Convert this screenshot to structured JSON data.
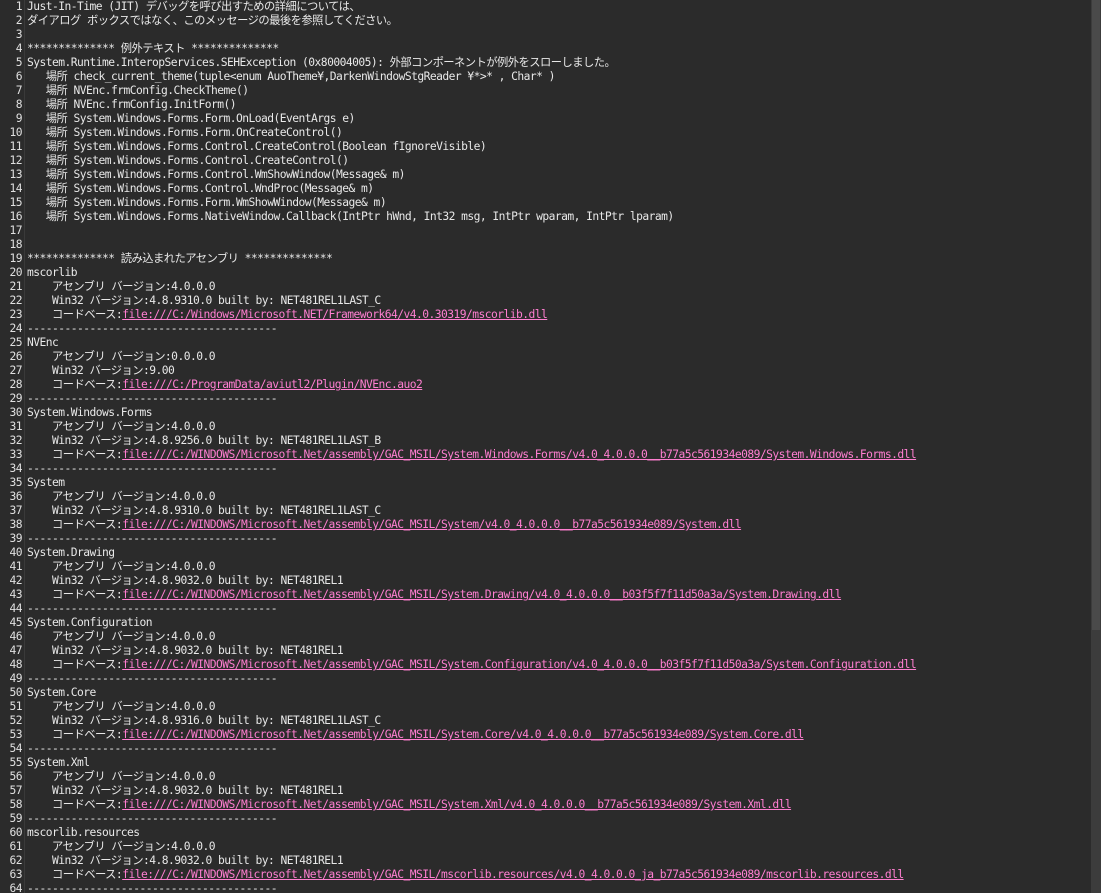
{
  "lines": [
    {
      "n": "1",
      "text": "Just-In-Time (JIT) デバッグを呼び出すための詳細については、"
    },
    {
      "n": "2",
      "text": "ダイアログ ボックスではなく、このメッセージの最後を参照してください。"
    },
    {
      "n": "3",
      "text": ""
    },
    {
      "n": "4",
      "text": "************** 例外テキスト **************"
    },
    {
      "n": "5",
      "text": "System.Runtime.InteropServices.SEHException (0x80004005): 外部コンポーネントが例外をスローしました。"
    },
    {
      "n": "6",
      "text": "   場所 check_current_theme(tuple<enum AuoTheme¥,DarkenWindowStgReader ¥*>* , Char* )"
    },
    {
      "n": "7",
      "text": "   場所 NVEnc.frmConfig.CheckTheme()"
    },
    {
      "n": "8",
      "text": "   場所 NVEnc.frmConfig.InitForm()"
    },
    {
      "n": "9",
      "text": "   場所 System.Windows.Forms.Form.OnLoad(EventArgs e)"
    },
    {
      "n": "10",
      "text": "   場所 System.Windows.Forms.Form.OnCreateControl()"
    },
    {
      "n": "11",
      "text": "   場所 System.Windows.Forms.Control.CreateControl(Boolean fIgnoreVisible)"
    },
    {
      "n": "12",
      "text": "   場所 System.Windows.Forms.Control.CreateControl()"
    },
    {
      "n": "13",
      "text": "   場所 System.Windows.Forms.Control.WmShowWindow(Message& m)"
    },
    {
      "n": "14",
      "text": "   場所 System.Windows.Forms.Control.WndProc(Message& m)"
    },
    {
      "n": "15",
      "text": "   場所 System.Windows.Forms.Form.WmShowWindow(Message& m)"
    },
    {
      "n": "16",
      "text": "   場所 System.Windows.Forms.NativeWindow.Callback(IntPtr hWnd, Int32 msg, IntPtr wparam, IntPtr lparam)"
    },
    {
      "n": "17",
      "text": ""
    },
    {
      "n": "18",
      "text": ""
    },
    {
      "n": "19",
      "text": "************** 読み込まれたアセンブリ **************"
    },
    {
      "n": "20",
      "text": "mscorlib"
    },
    {
      "n": "21",
      "text": "    アセンブリ バージョン:4.0.0.0"
    },
    {
      "n": "22",
      "text": "    Win32 バージョン:4.8.9310.0 built by: NET481REL1LAST_C"
    },
    {
      "n": "23",
      "text": "    コードベース:",
      "link": "file:///C:/Windows/Microsoft.NET/Framework64/v4.0.30319/mscorlib.dll"
    },
    {
      "n": "24",
      "text": "----------------------------------------"
    },
    {
      "n": "25",
      "text": "NVEnc"
    },
    {
      "n": "26",
      "text": "    アセンブリ バージョン:0.0.0.0"
    },
    {
      "n": "27",
      "text": "    Win32 バージョン:9.00"
    },
    {
      "n": "28",
      "text": "    コードベース:",
      "link": "file:///C:/ProgramData/aviutl2/Plugin/NVEnc.auo2"
    },
    {
      "n": "29",
      "text": "----------------------------------------"
    },
    {
      "n": "30",
      "text": "System.Windows.Forms"
    },
    {
      "n": "31",
      "text": "    アセンブリ バージョン:4.0.0.0"
    },
    {
      "n": "32",
      "text": "    Win32 バージョン:4.8.9256.0 built by: NET481REL1LAST_B"
    },
    {
      "n": "33",
      "text": "    コードベース:",
      "link": "file:///C:/WINDOWS/Microsoft.Net/assembly/GAC_MSIL/System.Windows.Forms/v4.0_4.0.0.0__b77a5c561934e089/System.Windows.Forms.dll"
    },
    {
      "n": "34",
      "text": "----------------------------------------"
    },
    {
      "n": "35",
      "text": "System"
    },
    {
      "n": "36",
      "text": "    アセンブリ バージョン:4.0.0.0"
    },
    {
      "n": "37",
      "text": "    Win32 バージョン:4.8.9310.0 built by: NET481REL1LAST_C"
    },
    {
      "n": "38",
      "text": "    コードベース:",
      "link": "file:///C:/WINDOWS/Microsoft.Net/assembly/GAC_MSIL/System/v4.0_4.0.0.0__b77a5c561934e089/System.dll"
    },
    {
      "n": "39",
      "text": "----------------------------------------"
    },
    {
      "n": "40",
      "text": "System.Drawing"
    },
    {
      "n": "41",
      "text": "    アセンブリ バージョン:4.0.0.0"
    },
    {
      "n": "42",
      "text": "    Win32 バージョン:4.8.9032.0 built by: NET481REL1"
    },
    {
      "n": "43",
      "text": "    コードベース:",
      "link": "file:///C:/WINDOWS/Microsoft.Net/assembly/GAC_MSIL/System.Drawing/v4.0_4.0.0.0__b03f5f7f11d50a3a/System.Drawing.dll"
    },
    {
      "n": "44",
      "text": "----------------------------------------"
    },
    {
      "n": "45",
      "text": "System.Configuration"
    },
    {
      "n": "46",
      "text": "    アセンブリ バージョン:4.0.0.0"
    },
    {
      "n": "47",
      "text": "    Win32 バージョン:4.8.9032.0 built by: NET481REL1"
    },
    {
      "n": "48",
      "text": "    コードベース:",
      "link": "file:///C:/WINDOWS/Microsoft.Net/assembly/GAC_MSIL/System.Configuration/v4.0_4.0.0.0__b03f5f7f11d50a3a/System.Configuration.dll"
    },
    {
      "n": "49",
      "text": "----------------------------------------"
    },
    {
      "n": "50",
      "text": "System.Core"
    },
    {
      "n": "51",
      "text": "    アセンブリ バージョン:4.0.0.0"
    },
    {
      "n": "52",
      "text": "    Win32 バージョン:4.8.9316.0 built by: NET481REL1LAST_C"
    },
    {
      "n": "53",
      "text": "    コードベース:",
      "link": "file:///C:/WINDOWS/Microsoft.Net/assembly/GAC_MSIL/System.Core/v4.0_4.0.0.0__b77a5c561934e089/System.Core.dll"
    },
    {
      "n": "54",
      "text": "----------------------------------------"
    },
    {
      "n": "55",
      "text": "System.Xml"
    },
    {
      "n": "56",
      "text": "    アセンブリ バージョン:4.0.0.0"
    },
    {
      "n": "57",
      "text": "    Win32 バージョン:4.8.9032.0 built by: NET481REL1"
    },
    {
      "n": "58",
      "text": "    コードベース:",
      "link": "file:///C:/WINDOWS/Microsoft.Net/assembly/GAC_MSIL/System.Xml/v4.0_4.0.0.0__b77a5c561934e089/System.Xml.dll"
    },
    {
      "n": "59",
      "text": "----------------------------------------"
    },
    {
      "n": "60",
      "text": "mscorlib.resources"
    },
    {
      "n": "61",
      "text": "    アセンブリ バージョン:4.0.0.0"
    },
    {
      "n": "62",
      "text": "    Win32 バージョン:4.8.9032.0 built by: NET481REL1"
    },
    {
      "n": "63",
      "text": "    コードベース:",
      "link": "file:///C:/WINDOWS/Microsoft.Net/assembly/GAC_MSIL/mscorlib.resources/v4.0_4.0.0.0_ja_b77a5c561934e089/mscorlib.resources.dll"
    },
    {
      "n": "64",
      "text": "----------------------------------------"
    }
  ]
}
